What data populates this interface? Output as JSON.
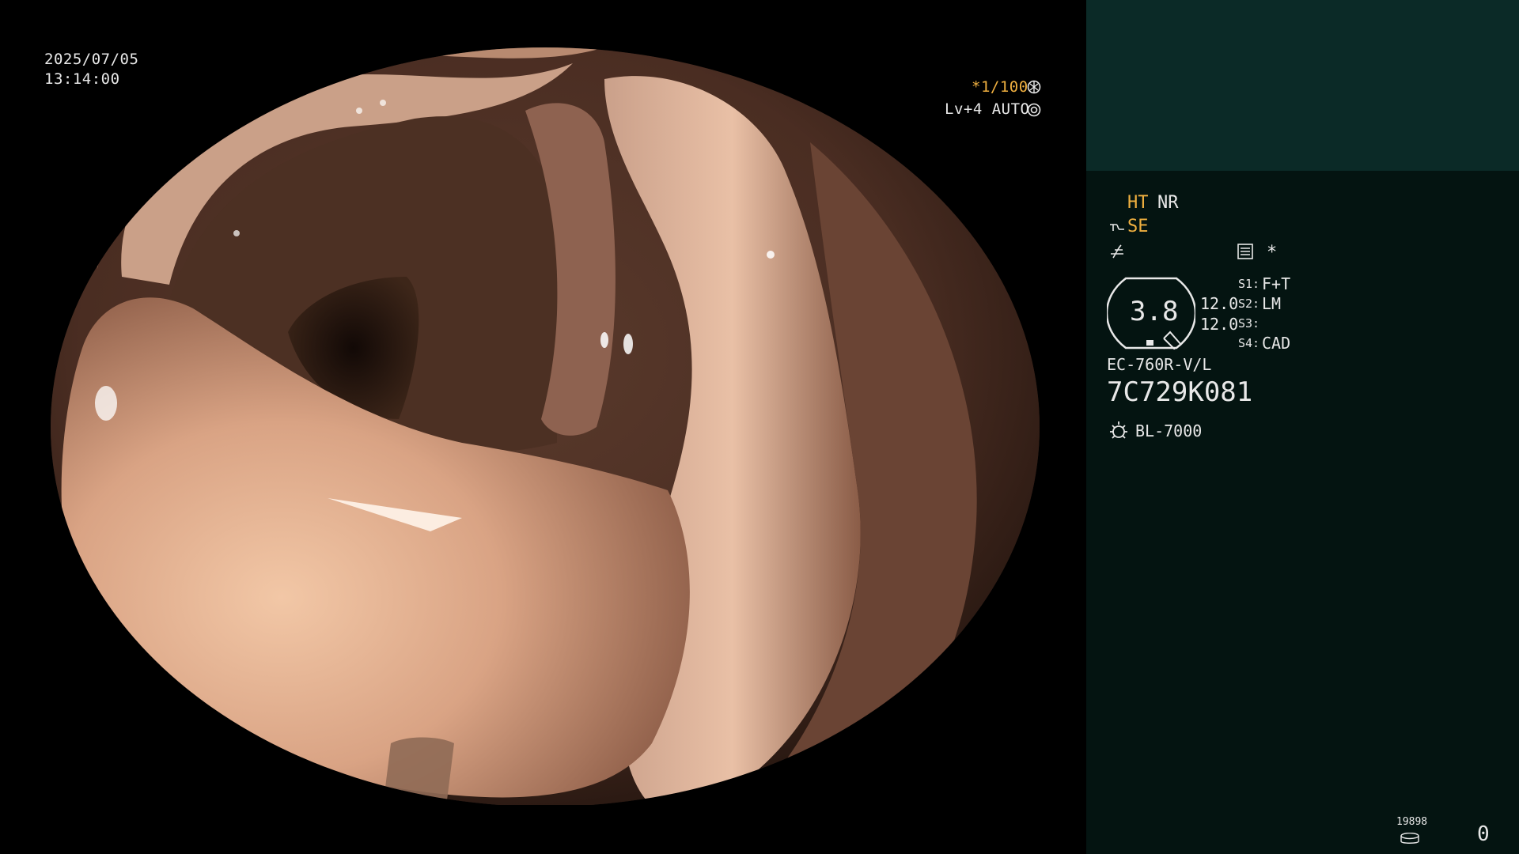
{
  "overlay": {
    "date": "2025/07/05",
    "time": "13:14:00",
    "shutter": "*1/100",
    "shutter_icon": "aperture-icon",
    "level": "Lv+4 AUTO",
    "level_icon": "iris-icon"
  },
  "panel": {
    "ht_label": "HT",
    "nr_label": "NR",
    "se_label": "SE",
    "star": "*",
    "gauge_value": "3.8",
    "value_a": "12.0",
    "value_b": "12.0",
    "s1_key": "S1:",
    "s1_val": "F+T",
    "s2_key": "S2:",
    "s2_val": "LM",
    "s3_key": "S3:",
    "s3_val": "",
    "s4_key": "S4:",
    "s4_val": "CAD",
    "scope_model": "EC-760R-V/L",
    "serial": "7C729K081",
    "light_source": "BL-7000",
    "counter_small": "19898",
    "counter": "0"
  },
  "colors": {
    "accent": "#f0b040",
    "panel_bg": "#041411",
    "panel_top": "#0b2a27"
  }
}
